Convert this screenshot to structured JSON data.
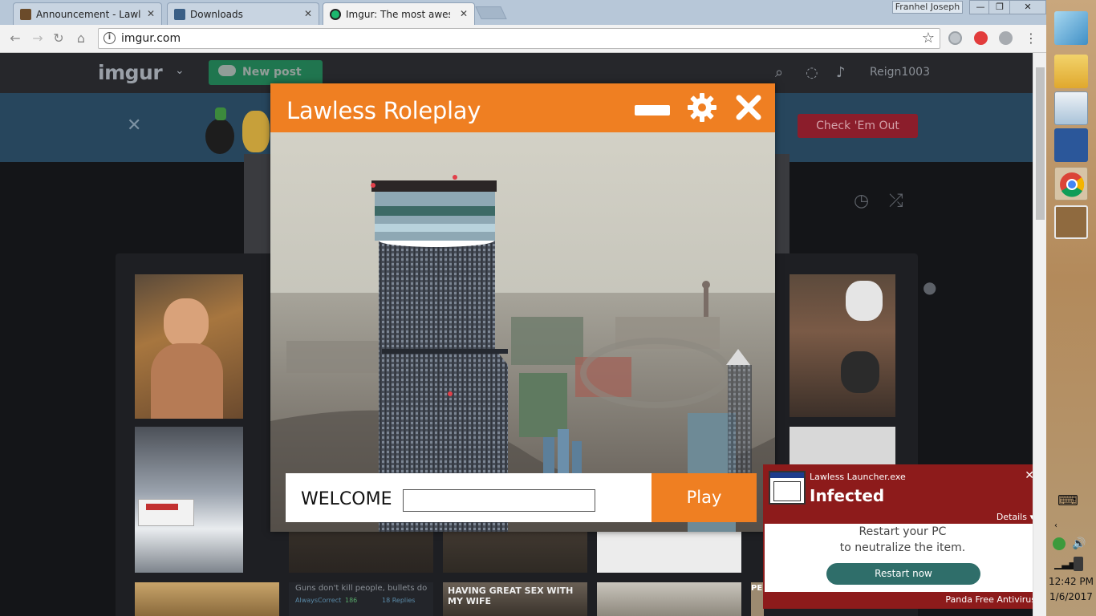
{
  "browser": {
    "tabs": [
      {
        "title": "Announcement - Lawless",
        "favicon": "lawless-favicon"
      },
      {
        "title": "Downloads",
        "favicon": "downloads-favicon"
      },
      {
        "title": "Imgur: The most awesome",
        "favicon": "imgur-favicon"
      }
    ],
    "profile_name": "Franhel Joseph",
    "address": "imgur.com",
    "window_controls": {
      "minimize": "—",
      "restore": "❐",
      "close": "✕"
    }
  },
  "imgur": {
    "logo": "imgur",
    "new_post_label": "New post",
    "username": "Reign1003",
    "banner_cta": "Check 'Em Out",
    "thumbs": {
      "t2_caption": "Guns don't kill people, bullets do",
      "t2_author": "AlwaysCorrect",
      "t2_votes": "186",
      "t2_replies": "18 Replies",
      "t3_caption": "HAVING GREAT SEX WITH MY WIFE",
      "t5_caption": "PERSON"
    }
  },
  "launcher": {
    "title": "Lawless Roleplay",
    "welcome_label": "WELCOME",
    "username_value": "",
    "play_label": "Play"
  },
  "antivirus": {
    "file": "Lawless Launcher.exe",
    "status": "Infected",
    "details_label": "Details",
    "message_line1": "Restart your PC",
    "message_line2": "to neutralize the item.",
    "action_label": "Restart now",
    "brand": "Panda Free Antivirus"
  },
  "taskbar": {
    "time": "12:42 PM",
    "date": "1/6/2017"
  },
  "colors": {
    "launcher_accent": "#ef7f22",
    "antivirus_red": "#8d1b1b",
    "restart_teal": "#2f6e6a",
    "imgur_green": "#1bb76e"
  }
}
